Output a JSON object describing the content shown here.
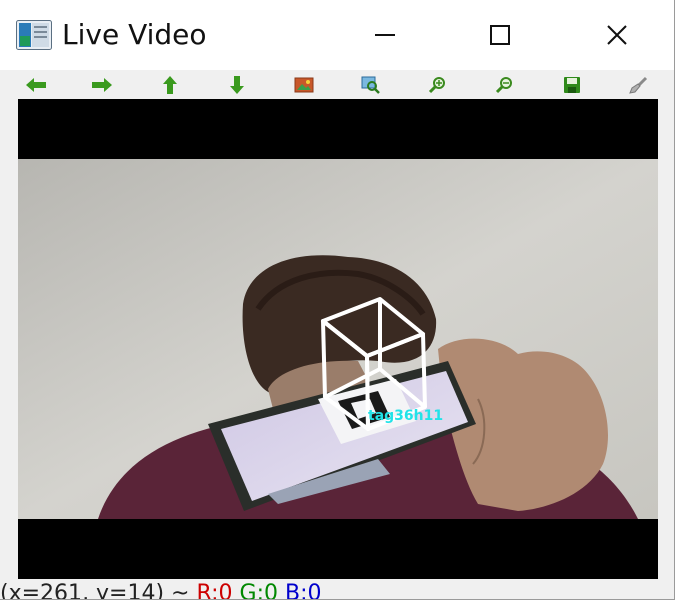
{
  "window": {
    "title": "Live Video"
  },
  "title_controls": {
    "minimize": "minimize-icon",
    "maximize": "maximize-icon",
    "close": "close-icon"
  },
  "toolbar": {
    "buttons": [
      "pan-left-icon",
      "pan-right-icon",
      "pan-up-icon",
      "pan-down-icon",
      "zoom-image-icon",
      "zoom-fit-icon",
      "zoom-in-icon",
      "zoom-out-icon",
      "save-icon",
      "properties-icon"
    ],
    "accent": "#3a9a1e"
  },
  "video": {
    "tag_label": "tag36h11",
    "tag_color": "#21e3e8"
  },
  "statusbar": {
    "coords": "(x=261, y=14) ~",
    "r_text": "R:0",
    "g_text": "G:0",
    "b_text": "B:0"
  }
}
